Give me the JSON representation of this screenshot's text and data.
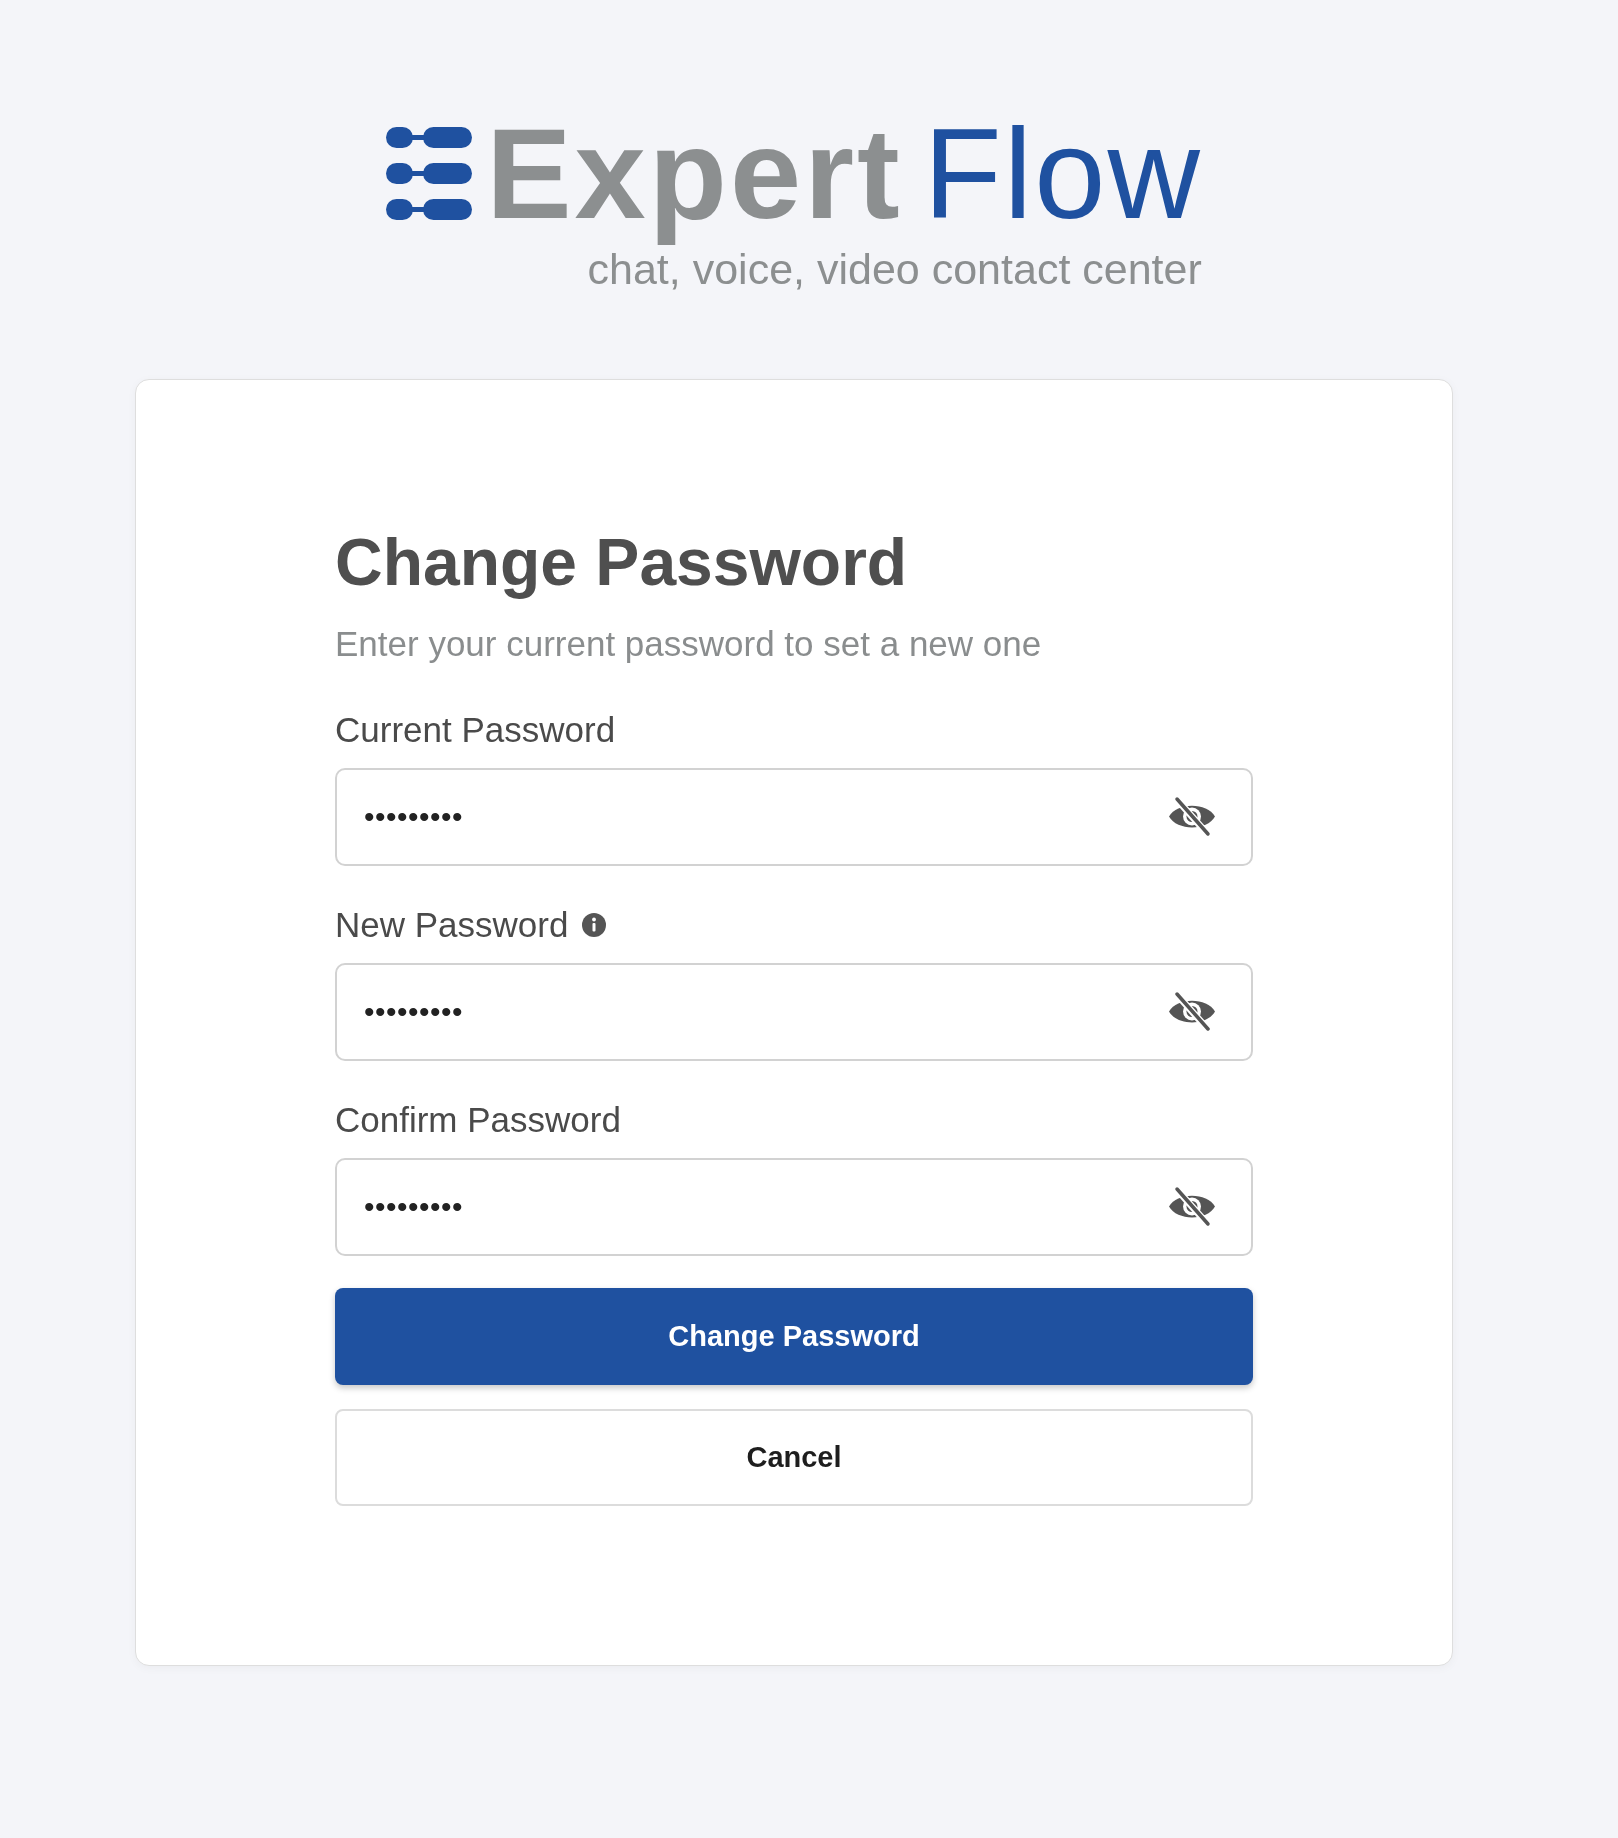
{
  "logo": {
    "wordmark": [
      {
        "text": "Expert",
        "bold": true,
        "color": "#8c8f90"
      },
      {
        "text": "Flow",
        "bold": false,
        "color": "#1f51a0"
      }
    ],
    "tagline": "chat, voice, video contact center"
  },
  "form": {
    "title": "Change Password",
    "subtitle": "Enter your current password to set a new one",
    "fields": [
      {
        "label": "Current Password",
        "info": false,
        "value": "•••••••••",
        "password_visible": false
      },
      {
        "label": "New Password",
        "info": true,
        "value": "•••••••••",
        "password_visible": false
      },
      {
        "label": "Confirm Password",
        "info": false,
        "value": "•••••••••",
        "password_visible": false
      }
    ],
    "buttons": [
      {
        "label": "Change Password",
        "kind": "primary"
      },
      {
        "label": "Cancel",
        "kind": "secondary"
      }
    ]
  }
}
